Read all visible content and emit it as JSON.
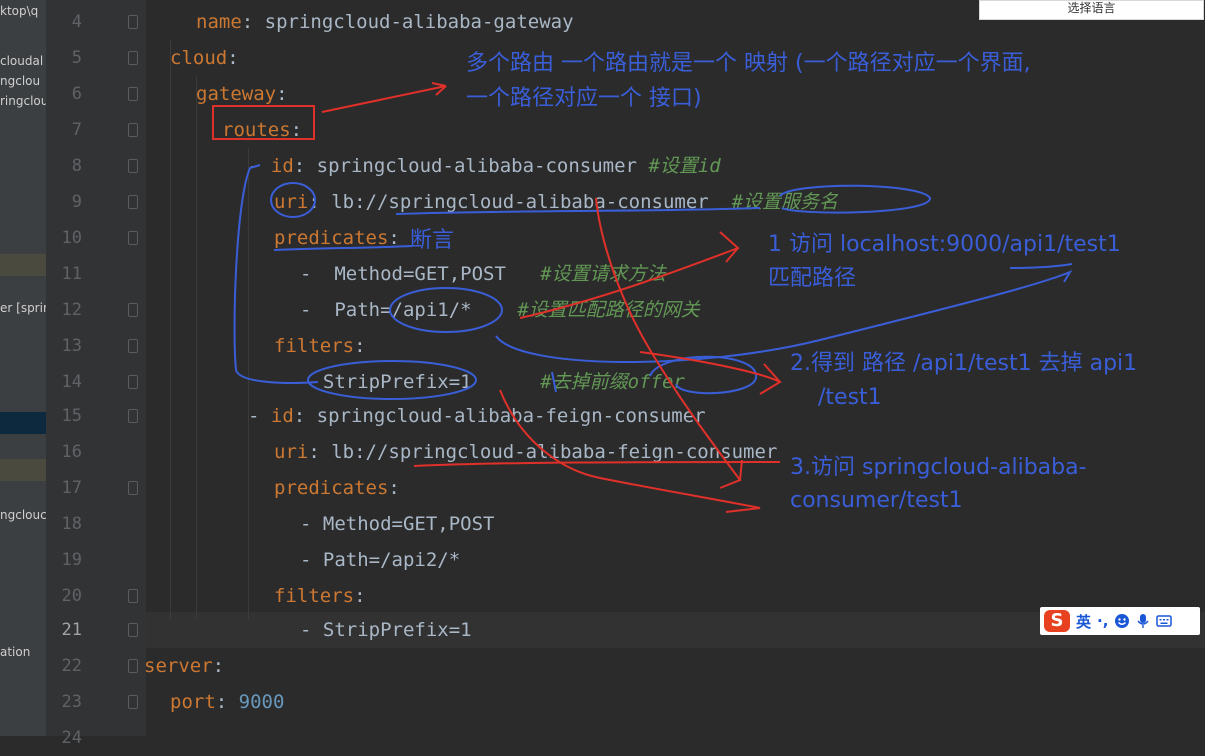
{
  "left_panel": {
    "items": [
      "ktop\\q",
      "cloudal",
      "ngclou",
      "ringclou",
      "er [sprin",
      "ngclouc",
      "ation"
    ]
  },
  "lines": [
    {
      "num": "4"
    },
    {
      "num": "5"
    },
    {
      "num": "6"
    },
    {
      "num": "7"
    },
    {
      "num": "8"
    },
    {
      "num": "9"
    },
    {
      "num": "10"
    },
    {
      "num": "11"
    },
    {
      "num": "12"
    },
    {
      "num": "13"
    },
    {
      "num": "14"
    },
    {
      "num": "15"
    },
    {
      "num": "16"
    },
    {
      "num": "17"
    },
    {
      "num": "18"
    },
    {
      "num": "19"
    },
    {
      "num": "20"
    },
    {
      "num": "21"
    },
    {
      "num": "22"
    },
    {
      "num": "23"
    },
    {
      "num": "24"
    }
  ],
  "code": {
    "l4": {
      "key": "name",
      "sep": ": ",
      "value": "springcloud-alibaba-gateway"
    },
    "l5": {
      "key": "cloud",
      "sep": ":"
    },
    "l6": {
      "key": "gateway",
      "sep": ":"
    },
    "l7": {
      "key": "routes",
      "sep": ":"
    },
    "l8": {
      "dash": "- ",
      "key": "id",
      "sep": ": ",
      "value": "springcloud-alibaba-consumer ",
      "comment": "#设置id"
    },
    "l9": {
      "key": "uri",
      "sep": ": ",
      "value": "lb://springcloud-alibaba-consumer  ",
      "comment": "#设置服务名"
    },
    "l10": {
      "key": "predicates",
      "sep": ":"
    },
    "l11": {
      "text": "-  Method=GET,POST   ",
      "comment": "#设置请求方法"
    },
    "l12": {
      "text": "-  Path=/api1/*    ",
      "comment": "#设置匹配路径的网关"
    },
    "l13": {
      "key": "filters",
      "sep": ":"
    },
    "l14": {
      "text": "- StripPrefix=1      ",
      "comment": "#去掉前缀offer"
    },
    "l15": {
      "dash": "- ",
      "key": "id",
      "sep": ": ",
      "value": "springcloud-alibaba-feign-consumer"
    },
    "l16": {
      "key": "uri",
      "sep": ": ",
      "value": "lb://springcloud-alibaba-feign-consumer"
    },
    "l17": {
      "key": "predicates",
      "sep": ":"
    },
    "l18": {
      "text": "- Method=GET,POST"
    },
    "l19": {
      "text": "- Path=/api2/*"
    },
    "l20": {
      "key": "filters",
      "sep": ":"
    },
    "l21": {
      "text": "- StripPrefix=1"
    },
    "l22": {
      "key": "server",
      "sep": ":"
    },
    "l23": {
      "key": "port",
      "sep": ": ",
      "number": "9000"
    }
  },
  "language_button": "选择语言",
  "annotations": {
    "routes_note_1": "多个路由  一个路由就是一个 映射 (一个路径对应一个界面,",
    "routes_note_2": "一个路径对应一个 接口)",
    "predicates_note": "断言",
    "step1_line1": "1 访问 localhost:9000/api1/test1",
    "step1_line2": "匹配路径",
    "step2_line1": "2.得到 路径 /api1/test1 去掉 api1",
    "step2_line2": "/test1",
    "step3_line1": "3.访问 springcloud-alibaba-",
    "step3_line2": "consumer/test1"
  },
  "ime_toolbar": {
    "logo": "S",
    "mode": "英",
    "punct": "·,"
  },
  "colors": {
    "annotation_blue": "#3a5ed8",
    "annotation_red": "#e0302a",
    "highlight_box": "#e0302a"
  }
}
